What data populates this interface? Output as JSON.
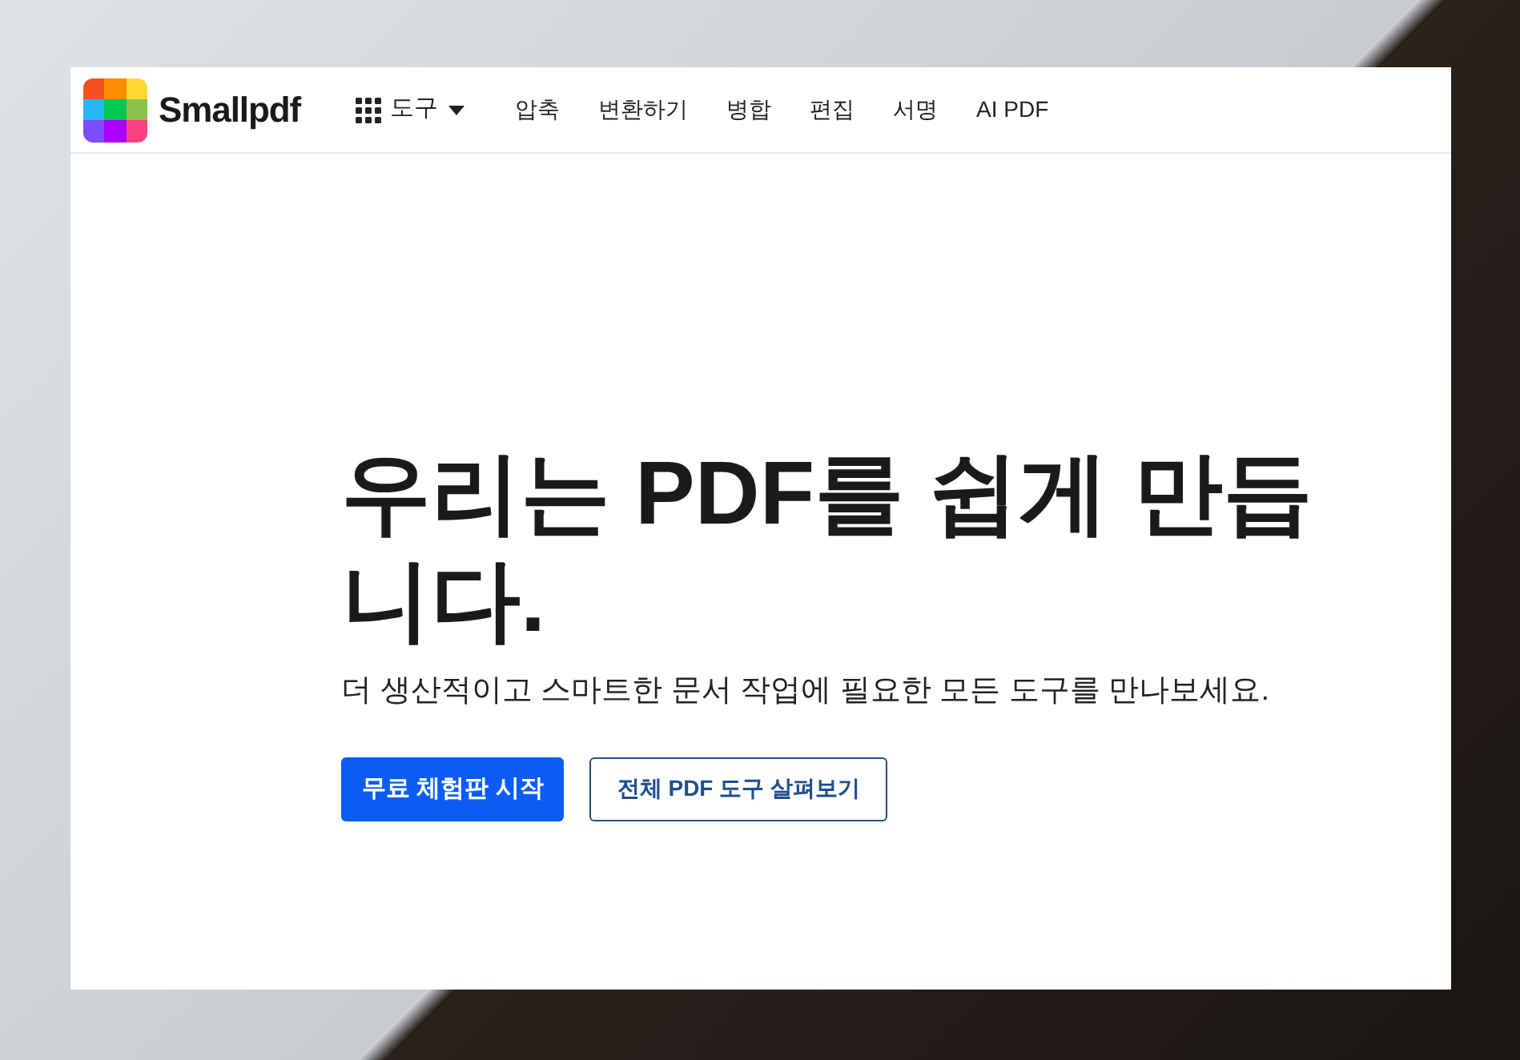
{
  "header": {
    "brand": "Smallpdf",
    "tools_menu": "도구",
    "nav": [
      "압축",
      "변환하기",
      "병합",
      "편집",
      "서명",
      "AI PDF"
    ]
  },
  "hero": {
    "headline": "우리는 PDF를 쉽게 만듭니다.",
    "subtitle": "더 생산적이고 스마트한 문서 작업에 필요한 모든 도구를 만나보세요.",
    "primary_button": "무료 체험판 시작",
    "secondary_button": "전체 PDF 도구 살펴보기"
  }
}
